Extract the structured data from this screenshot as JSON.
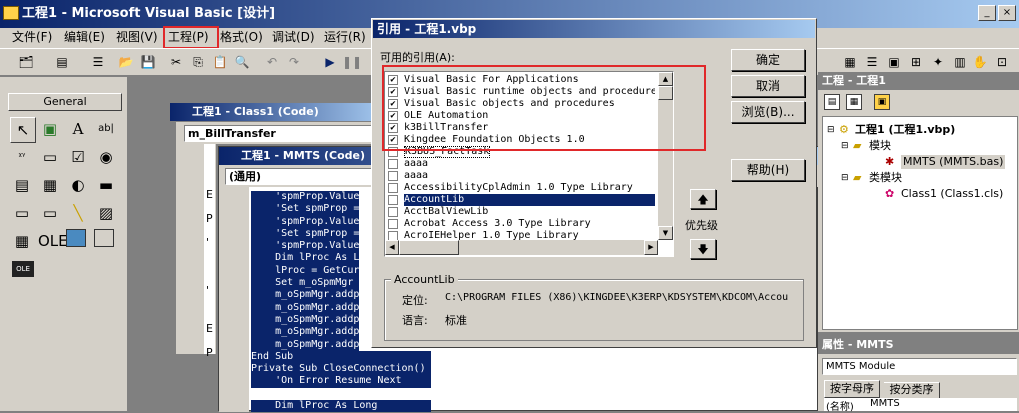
{
  "main_window": {
    "title": "工程1 - Microsoft Visual Basic [设计]"
  },
  "menu": [
    "文件(F)",
    "编辑(E)",
    "视图(V)",
    "工程(P)",
    "格式(O)",
    "调试(D)",
    "运行(R)"
  ],
  "toolbox": {
    "title": "General",
    "tools": [
      "↖",
      "▣",
      "A",
      "ab|",
      "ᵡᵞ",
      "▭",
      "☑",
      "◉",
      "▤",
      "▦",
      "◐",
      "▬",
      "▭",
      "▭",
      "╲",
      "▨",
      "▦",
      "OLE"
    ]
  },
  "class_window": {
    "title": "工程1 - Class1 (Code)",
    "object_combo": "m_BillTransfer"
  },
  "module_window": {
    "title": "工程1 - MMTS (Code)",
    "object_combo": "(通用)",
    "margin_markers": [
      "E",
      "P",
      "'",
      "'",
      "E",
      "P"
    ],
    "code_lines": [
      {
        "text": "    'spmProp.Value = ",
        "sel": true,
        "cmt": true
      },
      {
        "text": "    'Set spmProp = s",
        "sel": true,
        "cmt": true
      },
      {
        "text": "    'spmProp.Value =",
        "sel": true,
        "cmt": true
      },
      {
        "text": "    'Set spmProp = s",
        "sel": true,
        "cmt": true
      },
      {
        "text": "    'spmProp.Value =",
        "sel": true,
        "cmt": true
      },
      {
        "text": "    Dim lProc As Lon",
        "sel": true,
        "cmt": false
      },
      {
        "text": "    lProc = GetCurre",
        "sel": true,
        "cmt": false
      },
      {
        "text": "    Set m_oSpmMgr = ",
        "sel": true,
        "cmt": false
      },
      {
        "text": "    m_oSpmMgr.addpro",
        "sel": true,
        "cmt": false
      },
      {
        "text": "    m_oSpmMgr.addpro",
        "sel": true,
        "cmt": false
      },
      {
        "text": "    m_oSpmMgr.addpro",
        "sel": true,
        "cmt": false
      },
      {
        "text": "    m_oSpmMgr.addpro",
        "sel": true,
        "cmt": false
      },
      {
        "text": "    m_oSpmMgr.addpro",
        "sel": true,
        "cmt": false
      },
      {
        "text": "End Sub",
        "sel": true,
        "cmt": false
      },
      {
        "text": "Private Sub CloseConnection()",
        "sel": true,
        "cmt": false
      },
      {
        "text": "    'On Error Resume Next",
        "sel": true,
        "cmt": true
      },
      {
        "text": "",
        "sel": false,
        "cmt": false
      },
      {
        "text": "    Dim lProc As Long",
        "sel": true,
        "cmt": false
      }
    ]
  },
  "dialog": {
    "title": "引用 - 工程1.vbp",
    "available_label": "可用的引用(A):",
    "refs": [
      {
        "name": "Visual Basic For Applications",
        "checked": true
      },
      {
        "name": "Visual Basic runtime objects and procedures",
        "checked": true
      },
      {
        "name": "Visual Basic objects and procedures",
        "checked": true
      },
      {
        "name": "OLE Automation",
        "checked": true
      },
      {
        "name": "k3BillTransfer",
        "checked": true
      },
      {
        "name": "Kingdee Foundation Objects 1.0",
        "checked": true
      },
      {
        "name": "K3BUS_FactTask",
        "checked": false
      },
      {
        "name": "aaaa",
        "checked": false
      },
      {
        "name": "aaaa",
        "checked": false
      },
      {
        "name": "AccessibilityCplAdmin 1.0 Type Library",
        "checked": false
      },
      {
        "name": "AccountLib",
        "checked": false,
        "selected": true
      },
      {
        "name": "AcctBalViewLib",
        "checked": false
      },
      {
        "name": "Acrobat Access 3.0 Type Library",
        "checked": false
      },
      {
        "name": "AcroIEHelper 1.0 Type Library",
        "checked": false
      }
    ],
    "ok": "确定",
    "cancel": "取消",
    "browse": "浏览(B)...",
    "help": "帮助(H)",
    "priority": "优先级",
    "up_arrow": "🡅",
    "down_arrow": "🡇",
    "group_title": "AccountLib",
    "location_label": "定位:",
    "location_value": "C:\\PROGRAM FILES (X86)\\KINGDEE\\K3ERP\\KDSYSTEM\\KDCOM\\Accou",
    "language_label": "语言:",
    "language_value": "标准"
  },
  "project": {
    "title": "工程 - 工程1",
    "root": "工程1 (工程1.vbp)",
    "modules_folder": "模块",
    "module_item": "MMTS (MMTS.bas)",
    "class_folder": "类模块",
    "class_item": "Class1 (Class1.cls)"
  },
  "properties": {
    "title": "属性 - MMTS",
    "object": "MMTS Module",
    "tab_alpha": "按字母序",
    "tab_category": "按分类序",
    "first_row_name": "(名称)",
    "first_row_value": "MMTS"
  },
  "colors": {
    "highlight_box": "#e0282a",
    "selection": "#0a246a"
  }
}
